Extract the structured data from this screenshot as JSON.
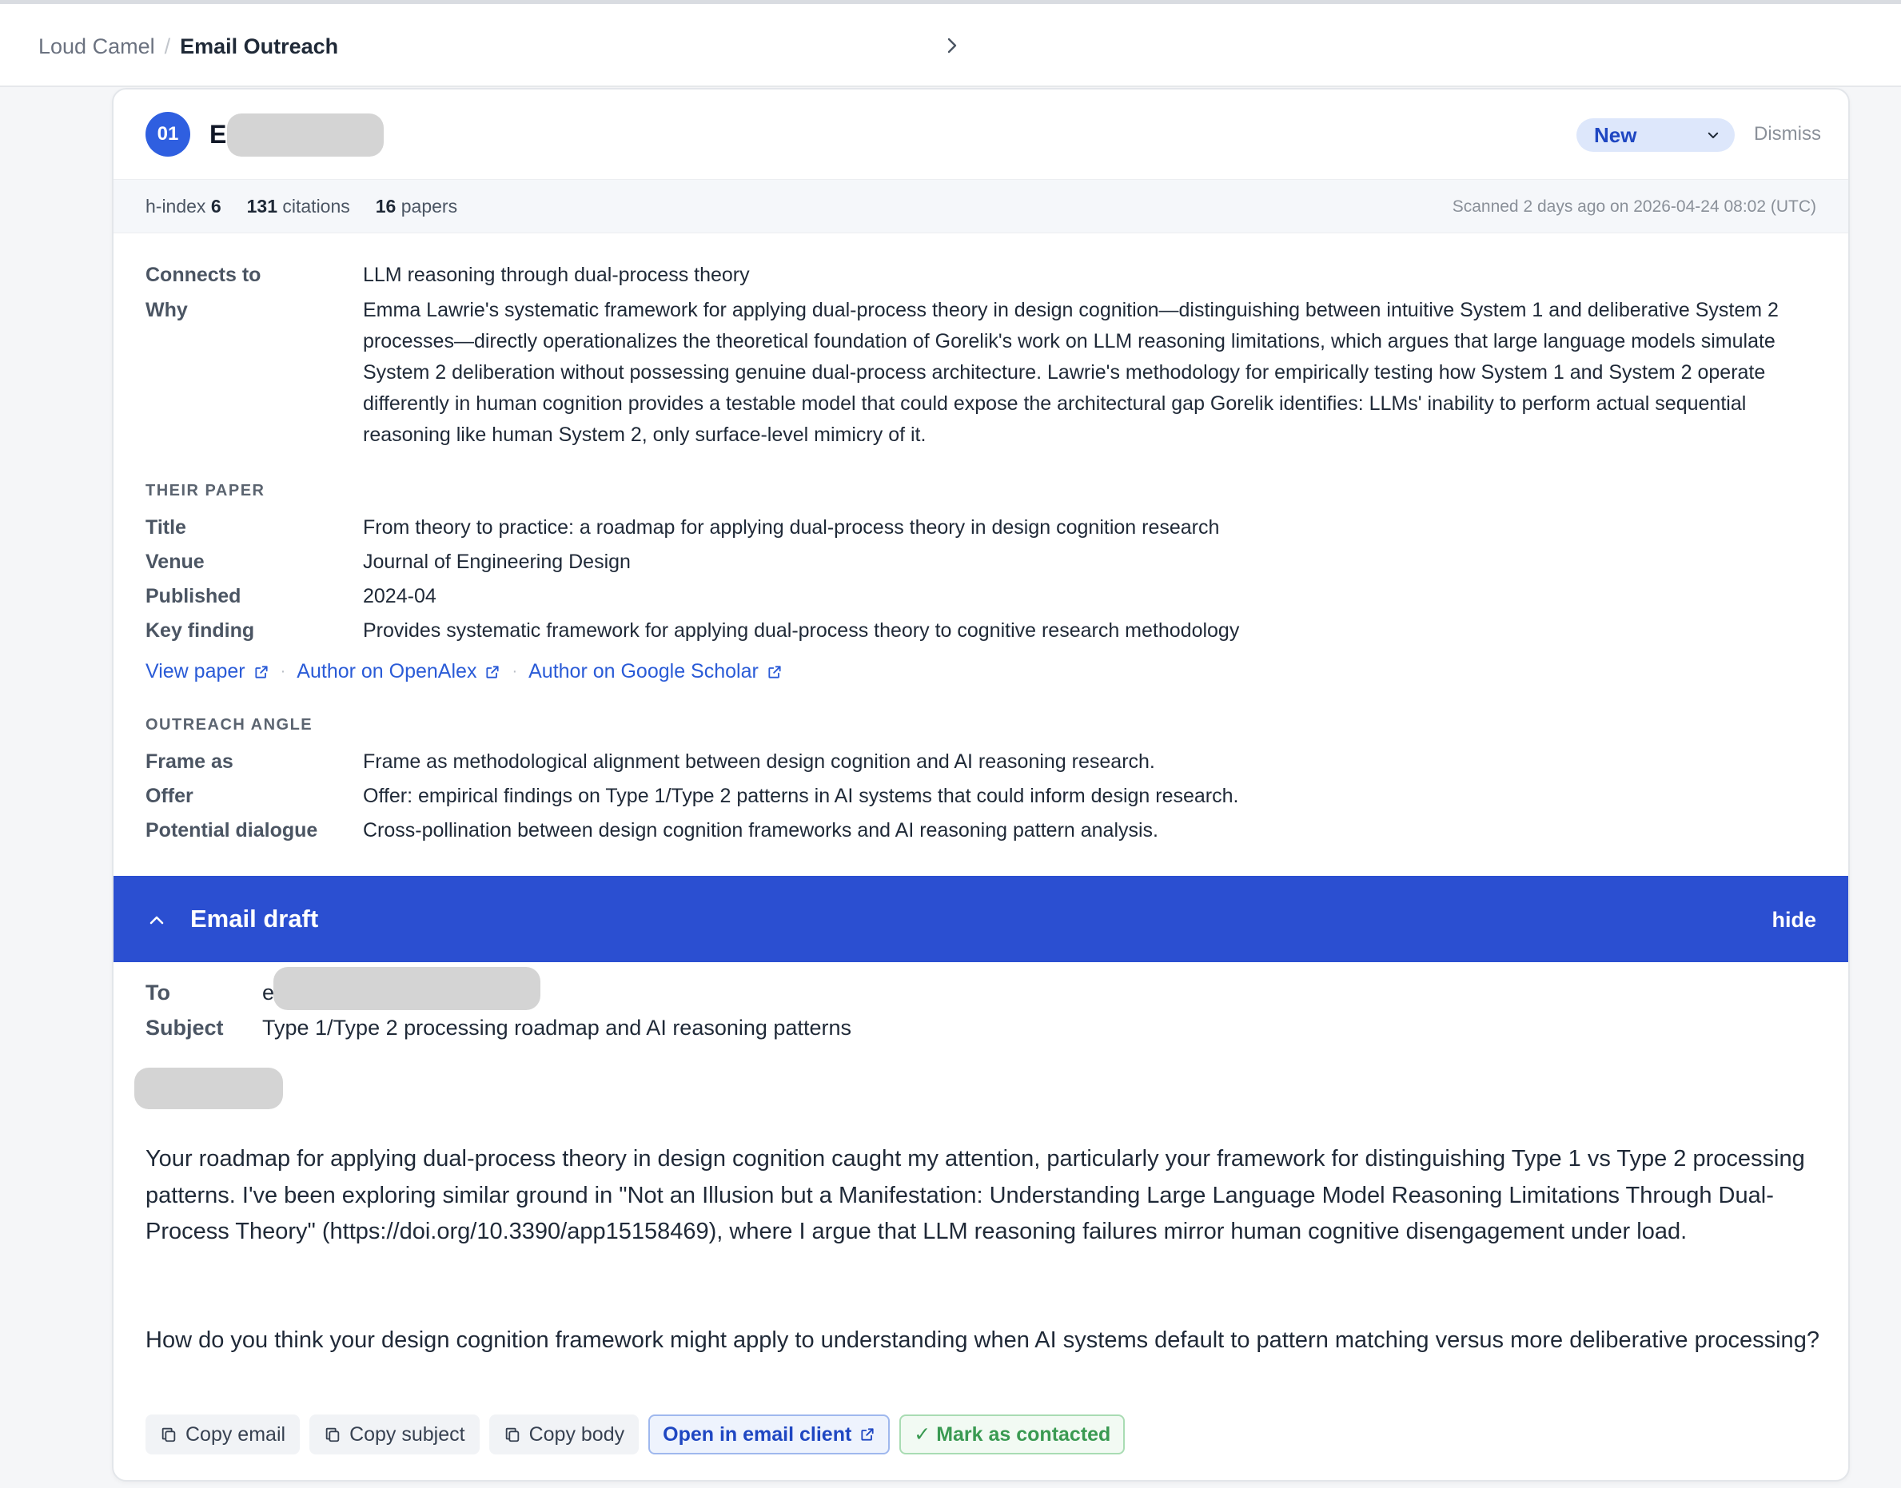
{
  "breadcrumb": {
    "root": "Loud Camel",
    "separator": "/",
    "current": "Email Outreach"
  },
  "card": {
    "rank": "01",
    "name_visible": "E",
    "status": "New",
    "dismiss": "Dismiss",
    "stats": {
      "hindex_label": "h-index",
      "hindex_value": "6",
      "citations_value": "131",
      "citations_label": "citations",
      "papers_value": "16",
      "papers_label": "papers"
    },
    "scanned": "Scanned 2 days ago on 2026-04-24 08:02 (UTC)",
    "connects_to_label": "Connects to",
    "connects_to": "LLM reasoning through dual-process theory",
    "why_label": "Why",
    "why": "Emma Lawrie's systematic framework for applying dual-process theory in design cognition—distinguishing between intuitive System 1 and deliberative System 2 processes—directly operationalizes the theoretical foundation of Gorelik's work on LLM reasoning limitations, which argues that large language models simulate System 2 deliberation without possessing genuine dual-process architecture. Lawrie's methodology for empirically testing how System 1 and System 2 operate differently in human cognition provides a testable model that could expose the architectural gap Gorelik identifies: LLMs' inability to perform actual sequential reasoning like human System 2, only surface-level mimicry of it.",
    "their_paper": {
      "heading": "THEIR PAPER",
      "title_label": "Title",
      "title": "From theory to practice: a roadmap for applying dual-process theory in design cognition research",
      "venue_label": "Venue",
      "venue": "Journal of Engineering Design",
      "published_label": "Published",
      "published": "2024-04",
      "key_finding_label": "Key finding",
      "key_finding": "Provides systematic framework for applying dual-process theory to cognitive research methodology"
    },
    "links": {
      "view_paper": "View paper",
      "openalex": "Author on OpenAlex",
      "scholar": "Author on Google Scholar",
      "dot": "·"
    },
    "outreach": {
      "heading": "OUTREACH ANGLE",
      "frame_label": "Frame as",
      "frame": "Frame as methodological alignment between design cognition and AI reasoning research.",
      "offer_label": "Offer",
      "offer": "Offer: empirical findings on Type 1/Type 2 patterns in AI systems that could inform design research.",
      "dialogue_label": "Potential dialogue",
      "dialogue": "Cross-pollination between design cognition frameworks and AI reasoning pattern analysis."
    }
  },
  "draft": {
    "title": "Email draft",
    "hide": "hide",
    "to_label": "To",
    "to_visible": "e",
    "subject_label": "Subject",
    "subject": "Type 1/Type 2 processing roadmap and AI reasoning patterns",
    "body_p1": "Your roadmap for applying dual-process theory in design cognition caught my attention, particularly your framework for distinguishing Type 1 vs Type 2 processing patterns. I've been exploring similar ground in \"Not an Illusion but a Manifestation: Understanding Large Language Model Reasoning Limitations Through Dual-Process Theory\" (https://doi.org/10.3390/app15158469), where I argue that LLM reasoning failures mirror human cognitive disengagement under load.",
    "body_p2": "How do you think your design cognition framework might apply to understanding when AI systems default to pattern matching versus more deliberative processing?",
    "actions": {
      "copy_email": "Copy email",
      "copy_subject": "Copy subject",
      "copy_body": "Copy body",
      "open_client": "Open in email client",
      "mark_contacted": "✓ Mark as contacted"
    }
  },
  "colors": {
    "accent": "#2b4fd1",
    "badge": "#2f5fe0",
    "link": "#2a5bd7",
    "success": "#3a9a52"
  }
}
